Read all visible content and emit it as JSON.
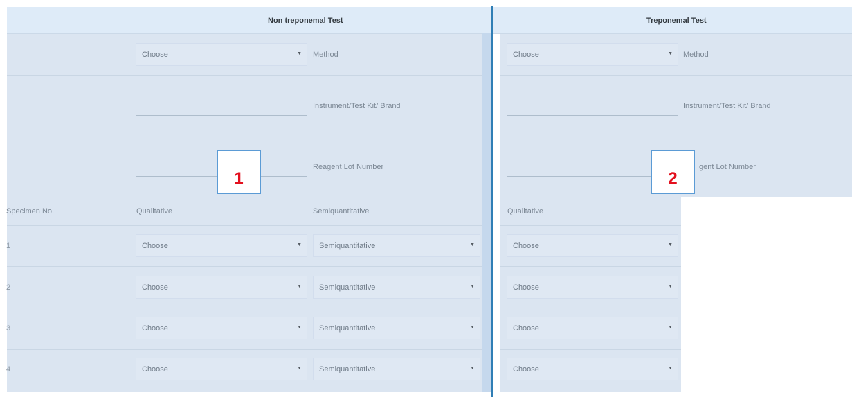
{
  "headers": {
    "non_treponemal": "Non treponemal Test",
    "treponemal": "Treponemal Test"
  },
  "rows_labels": {
    "method": "Method",
    "instrument": "Instrument/Test Kit/ Brand",
    "reagent": "Reagent Lot Number",
    "reagent_partial": "gent Lot Number"
  },
  "columns": {
    "specimen_no": "Specimen No.",
    "qualitative": "Qualitative",
    "semiquantitative": "Semiquantitative"
  },
  "select_placeholder": "Choose",
  "semi_placeholder": "Semiquantitative",
  "specimens": [
    "1",
    "2",
    "3",
    "4"
  ],
  "markers": {
    "m1": "1",
    "m2": "2"
  },
  "colors": {
    "header_bg": "#deebf8",
    "panel_bg": "#dbe5f1",
    "divider": "#2f7eb5",
    "marker_border": "#5b9bd5",
    "marker_text": "#e3101e"
  }
}
